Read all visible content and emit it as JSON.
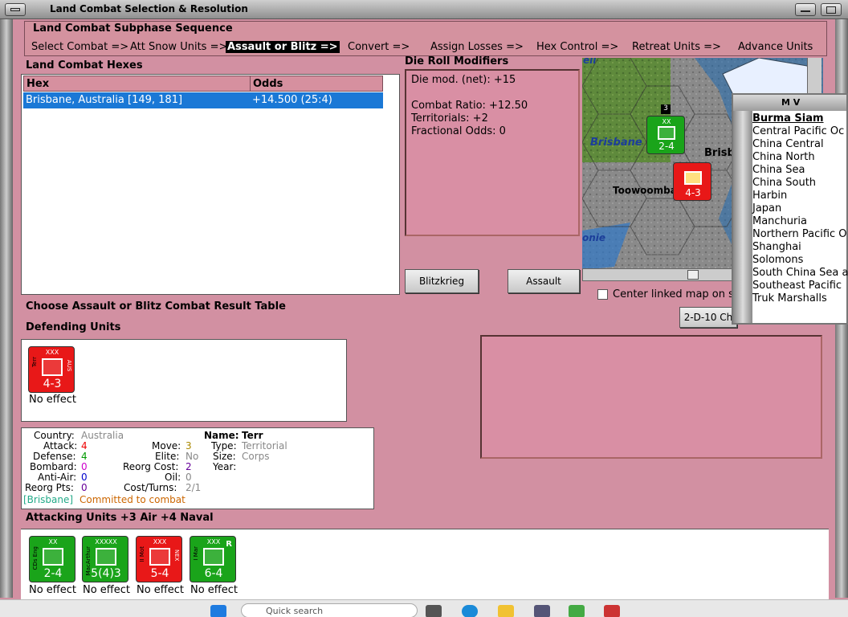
{
  "window": {
    "title": "Land Combat Selection & Resolution"
  },
  "subphase": {
    "header": "Land Combat Subphase Sequence",
    "steps": [
      "Select Combat =>",
      "Att Snow Units =>",
      "Assault or Blitz =>",
      "Convert =>",
      "Assign Losses =>",
      "Hex Control =>",
      "Retreat Units =>",
      "Advance Units"
    ],
    "active": "Assault or Blitz =>"
  },
  "hexes": {
    "label": "Land Combat Hexes",
    "columns": [
      "Hex",
      "Odds"
    ],
    "rows": [
      {
        "hex": "Brisbane, Australia [149, 181]",
        "odds": "+14.500 (25:4)"
      }
    ]
  },
  "drm": {
    "label": "Die Roll Modifiers",
    "net": "Die mod. (net): +15",
    "combat_ratio": "Combat Ratio: +12.50",
    "territorials": "Territorials: +2",
    "fractional": "Fractional Odds: 0"
  },
  "buttons": {
    "blitz": "Blitzkrieg",
    "assault": "Assault",
    "dice": "2-D-10 Ch"
  },
  "map": {
    "labels": {
      "brisbane": "Brisbane",
      "brisb": "Brisb",
      "toowoomba": "Toowoomba",
      "top": "ell",
      "bottom": "onie"
    },
    "stack_count": "3",
    "counters": {
      "green": {
        "size": "XX",
        "str": "2-4"
      },
      "red": {
        "str": "4-3"
      }
    }
  },
  "center_link": {
    "label": "Center linked map on s"
  },
  "mv_window": {
    "title": "M V",
    "items": [
      "Burma Siam",
      "Central Pacific Oc",
      "China Central",
      "China North",
      "China Sea",
      "China South",
      "Harbin",
      "Japan",
      "Manchuria",
      "Northern Pacific O",
      "Shanghai",
      "Solomons",
      "South China Sea a",
      "Southeast Pacific",
      "Truk Marshalls"
    ]
  },
  "crt_label": "Choose Assault or Blitz Combat Result Table",
  "defending": {
    "label": "Defending Units",
    "units": [
      {
        "size": "XXX",
        "name": "Terr",
        "nat": "AUS",
        "str": "4-3",
        "result": "No effect",
        "color": "#e81818"
      }
    ]
  },
  "details": {
    "country_k": "Country:",
    "country_v": "Australia",
    "attack_k": "Attack:",
    "attack_v": "4",
    "defense_k": "Defense:",
    "defense_v": "4",
    "bombard_k": "Bombard:",
    "bombard_v": "0",
    "antiair_k": "Anti-Air:",
    "antiair_v": "0",
    "reorg_k": "Reorg Pts:",
    "reorg_v": "0",
    "move_k": "Move:",
    "move_v": "3",
    "elite_k": "Elite:",
    "elite_v": "No",
    "reorgcost_k": "Reorg Cost:",
    "reorgcost_v": "2",
    "oil_k": "Oil:",
    "oil_v": "0",
    "cost_k": "Cost/Turns:",
    "cost_v": "2/1",
    "name_k": "Name:",
    "name_v": "Terr",
    "type_k": "Type:",
    "type_v": "Territorial",
    "size_k": "Size:",
    "size_v": "Corps",
    "year_k": "Year:",
    "loc": "[Brisbane]",
    "status": "Committed to combat"
  },
  "attacking": {
    "label": "Attacking Units +3 Air +4 Naval",
    "units": [
      {
        "size": "XX",
        "name": "CDs Eng",
        "nat": "",
        "str": "2-4",
        "result": "No effect",
        "color": "green"
      },
      {
        "size": "XXXXX",
        "name": "MacArthur",
        "nat": "",
        "str": "5(4)3",
        "result": "No effect",
        "color": "green"
      },
      {
        "size": "XXX",
        "name": "II Mot",
        "nat": "NEX",
        "str": "5-4",
        "result": "No effect",
        "color": "red"
      },
      {
        "size": "XXX",
        "name": "I Mar",
        "nat": "",
        "str": "6-4",
        "result": "No effect",
        "color": "green",
        "mark": "R"
      }
    ]
  },
  "taskbar": {
    "search": "Quick search"
  },
  "colors": {
    "panel": "#d290a2",
    "select": "#1a78d6",
    "green": "#1aa41a",
    "red": "#e81818"
  }
}
